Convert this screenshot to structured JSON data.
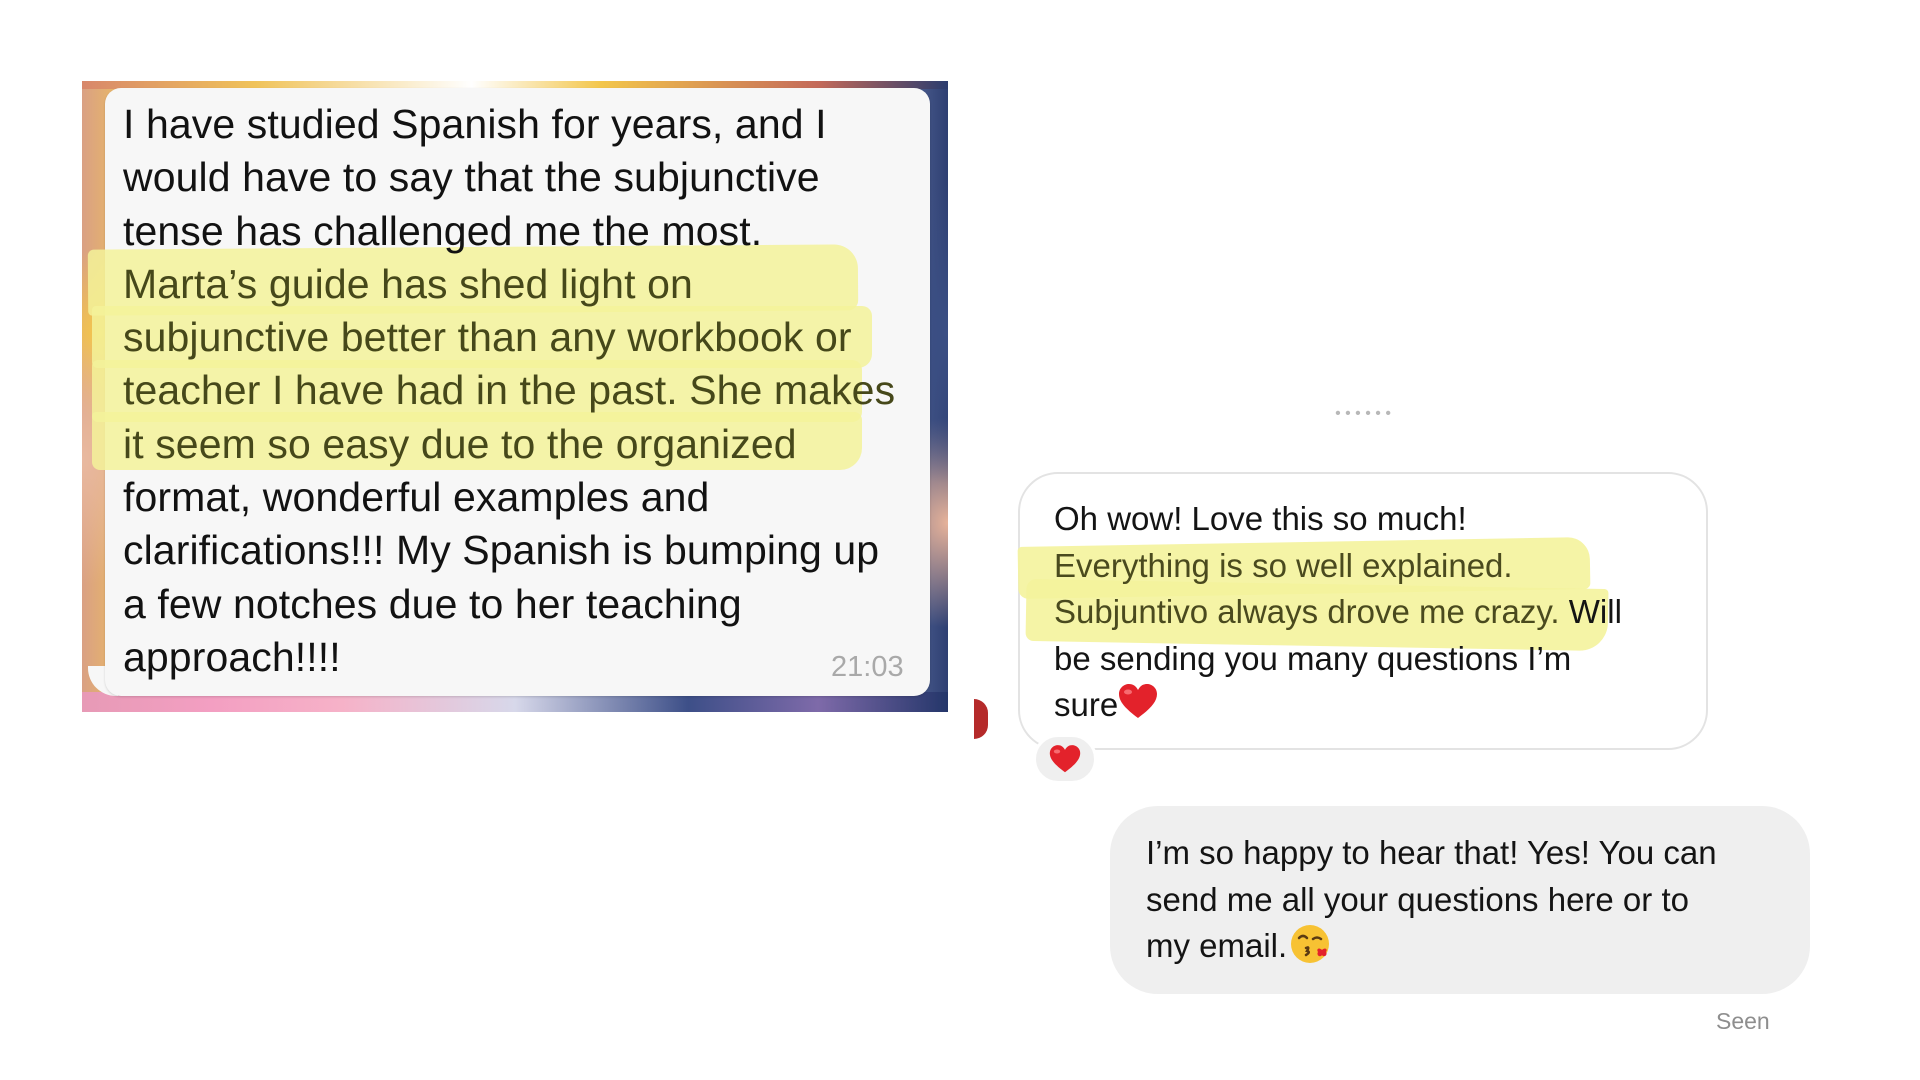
{
  "whatsapp_message": {
    "lines": [
      "I have studied Spanish for years, and I",
      "would have to say that the subjunctive",
      "tense has challenged me the most.",
      "Marta’s guide has shed light on",
      "subjunctive better than any workbook or",
      "teacher I have had in the past. She makes",
      "it seem so easy due to the organized",
      "format, wonderful examples and",
      "clarifications!!! My Spanish is bumping up",
      "a few notches due to her teaching",
      "approach!!!!"
    ],
    "time": "21:03",
    "highlight_color": "#f3f29a"
  },
  "dm_thread": {
    "received": {
      "line_1": "Oh wow! Love this so much!",
      "line_2": "Everything is so well explained.",
      "line_3_highlight": "Subjuntivo always drove me crazy.",
      "line_3_rest": " Will",
      "line_4": "be sending you many questions I’m",
      "line_5": "sure",
      "emoji": "red-heart-icon"
    },
    "reaction": "red-heart-icon",
    "sent": {
      "line_1": "I’m so happy to hear that! Yes! You can",
      "line_2": "send me all your questions here or to",
      "line_3": "my email.",
      "emoji": "face-blowing-kiss-icon"
    },
    "status": "Seen",
    "bubble_received_border": "#e3e3e3",
    "bubble_sent_bg": "#efefef"
  }
}
